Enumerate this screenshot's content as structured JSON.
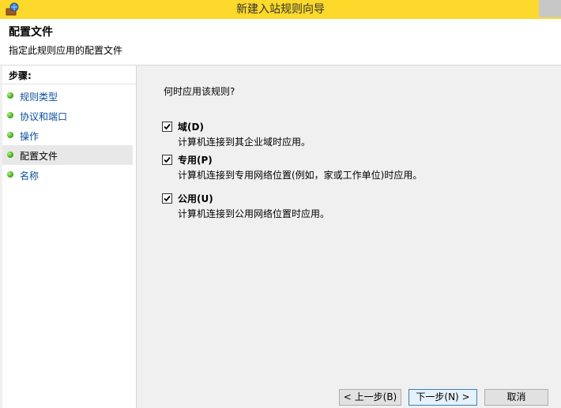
{
  "window": {
    "title": "新建入站规则向导"
  },
  "header": {
    "title": "配置文件",
    "subtitle": "指定此规则应用的配置文件"
  },
  "sidebar": {
    "title": "步骤:",
    "items": [
      {
        "label": "规则类型"
      },
      {
        "label": "协议和端口"
      },
      {
        "label": "操作"
      },
      {
        "label": "配置文件"
      },
      {
        "label": "名称"
      }
    ]
  },
  "main": {
    "question": "何时应用该规则?",
    "options": [
      {
        "label": "域(D)",
        "description": "计算机连接到其企业域时应用。",
        "checked": true
      },
      {
        "label": "专用(P)",
        "description": "计算机连接到专用网络位置(例如，家或工作单位)时应用。",
        "checked": true
      },
      {
        "label": "公用(U)",
        "description": "计算机连接到公用网络位置时应用。",
        "checked": true
      }
    ]
  },
  "buttons": {
    "back": "< 上一步(B)",
    "next": "下一步(N) >",
    "cancel": "取消"
  },
  "colors": {
    "titlebar": "#fcd92a",
    "link": "#0a4fa0",
    "status_dot": "#43b41d"
  }
}
